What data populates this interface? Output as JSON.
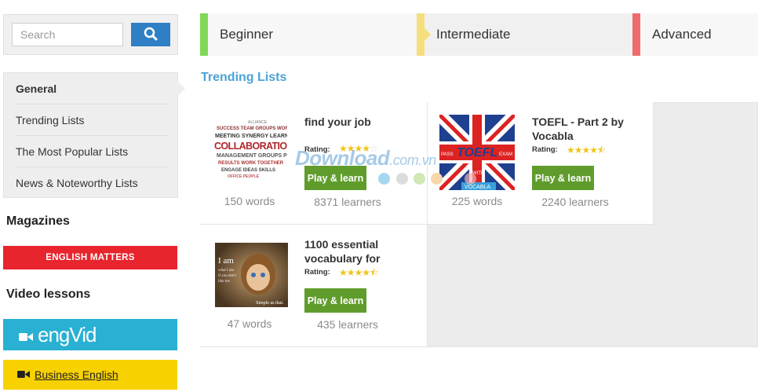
{
  "search": {
    "placeholder": "Search",
    "value": "",
    "icon": "search-icon"
  },
  "nav": {
    "items": [
      {
        "label": "General",
        "active": true
      },
      {
        "label": "Trending Lists"
      },
      {
        "label": "The Most Popular Lists"
      },
      {
        "label": "News & Noteworthy Lists"
      }
    ]
  },
  "magazines": {
    "heading": "Magazines",
    "banner": "ENGLISH MATTERS"
  },
  "video": {
    "heading": "Video lessons",
    "engvid_label": "engVid",
    "business_label": "Business English"
  },
  "levels": [
    {
      "label": "Beginner",
      "color": "#7ed957"
    },
    {
      "label": "Intermediate",
      "color": "#f5df7c"
    },
    {
      "label": "Advanced",
      "color": "#ef6b6b"
    }
  ],
  "trending": {
    "title": "Trending Lists",
    "cards": [
      {
        "title": "find your job",
        "rating_label": "Rating:",
        "rating": 4,
        "button": "Play & learn",
        "words": "150 words",
        "learners": "8371 learners",
        "thumb_label": "COLLABORATION"
      },
      {
        "title": "TOEFL - Part 2 by Vocabla",
        "rating_label": "Rating:",
        "rating": 4.5,
        "button": "Play & learn",
        "words": "225 words",
        "learners": "2240 learners",
        "thumb_label": "TOEFL"
      },
      {
        "title": "1100 essential vocabulary for",
        "rating_label": "Rating:",
        "rating": 4.5,
        "button": "Play & learn",
        "words": "47 words",
        "learners": "435 learners",
        "thumb_label": "I am"
      }
    ]
  },
  "watermark": {
    "text": "Download",
    "suffix": ".com.vn"
  }
}
